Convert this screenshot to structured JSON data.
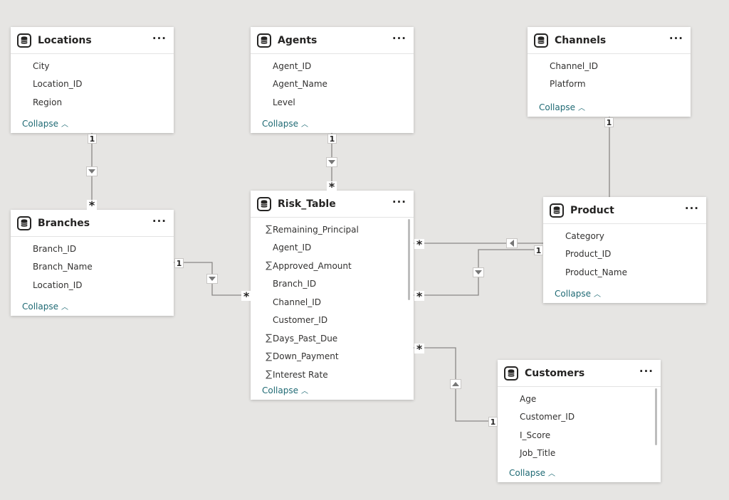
{
  "collapse_label": "Collapse",
  "more_label": "···",
  "tables": {
    "locations": {
      "title": "Locations",
      "fields": [
        {
          "name": "City",
          "sum": false
        },
        {
          "name": "Location_ID",
          "sum": false
        },
        {
          "name": "Region",
          "sum": false
        }
      ]
    },
    "agents": {
      "title": "Agents",
      "fields": [
        {
          "name": "Agent_ID",
          "sum": false
        },
        {
          "name": "Agent_Name",
          "sum": false
        },
        {
          "name": "Level",
          "sum": false
        }
      ]
    },
    "channels": {
      "title": "Channels",
      "fields": [
        {
          "name": "Channel_ID",
          "sum": false
        },
        {
          "name": "Platform",
          "sum": false
        }
      ]
    },
    "branches": {
      "title": "Branches",
      "fields": [
        {
          "name": "Branch_ID",
          "sum": false
        },
        {
          "name": "Branch_Name",
          "sum": false
        },
        {
          "name": "Location_ID",
          "sum": false
        }
      ]
    },
    "risk_table": {
      "title": "Risk_Table",
      "fields": [
        {
          "name": "Remaining_Principal",
          "sum": true
        },
        {
          "name": "Agent_ID",
          "sum": false
        },
        {
          "name": "Approved_Amount",
          "sum": true
        },
        {
          "name": "Branch_ID",
          "sum": false
        },
        {
          "name": "Channel_ID",
          "sum": false
        },
        {
          "name": "Customer_ID",
          "sum": false
        },
        {
          "name": "Days_Past_Due",
          "sum": true
        },
        {
          "name": "Down_Payment",
          "sum": true
        },
        {
          "name": "Interest Rate",
          "sum": true
        }
      ]
    },
    "product": {
      "title": "Product",
      "fields": [
        {
          "name": "Category",
          "sum": false
        },
        {
          "name": "Product_ID",
          "sum": false
        },
        {
          "name": "Product_Name",
          "sum": false
        }
      ]
    },
    "customers": {
      "title": "Customers",
      "fields": [
        {
          "name": "Age",
          "sum": false
        },
        {
          "name": "Customer_ID",
          "sum": false
        },
        {
          "name": "I_Score",
          "sum": false
        },
        {
          "name": "Job_Title",
          "sum": false
        }
      ]
    }
  },
  "cardinality": {
    "one": "1",
    "many": "*"
  },
  "sum_symbol": "∑"
}
